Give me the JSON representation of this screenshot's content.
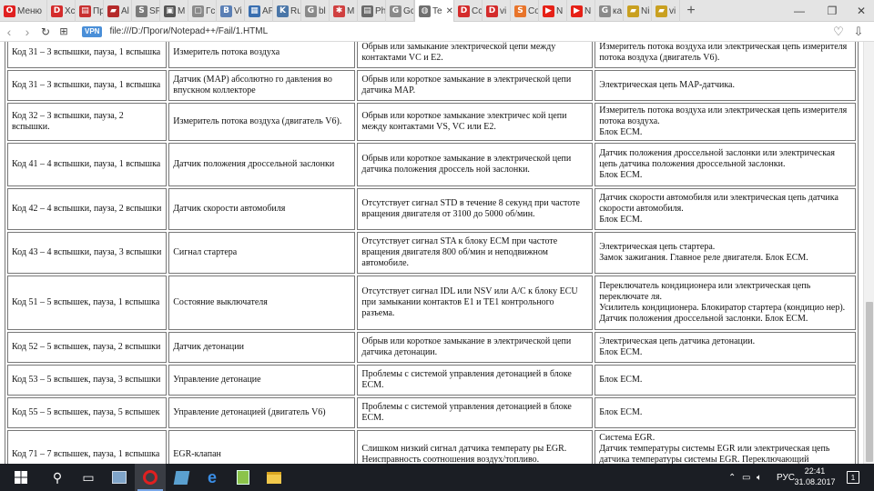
{
  "browser": {
    "tabs": [
      {
        "label": "Меню",
        "icon": "opera-menu-icon",
        "glyph": "O",
        "color": "#e02020"
      },
      {
        "label": "Xc",
        "icon": "d-site-icon",
        "glyph": "D",
        "color": "#d42b2b"
      },
      {
        "label": "Пр",
        "icon": "news-site-icon",
        "glyph": "▤",
        "color": "#c83030"
      },
      {
        "label": "Al",
        "icon": "car-site-icon",
        "glyph": "▰",
        "color": "#b52a2a"
      },
      {
        "label": "SF",
        "icon": "s-site-icon",
        "glyph": "S",
        "color": "#7a7a7a"
      },
      {
        "label": "M",
        "icon": "m-site-icon",
        "glyph": "▣",
        "color": "#555555"
      },
      {
        "label": "Гс",
        "icon": "page-icon",
        "glyph": "▢",
        "color": "#8a8a8a"
      },
      {
        "label": "Vi",
        "icon": "vk-icon",
        "glyph": "B",
        "color": "#5a7fb5"
      },
      {
        "label": "AF",
        "icon": "af-site-icon",
        "glyph": "▦",
        "color": "#3a6fb0"
      },
      {
        "label": "Ru",
        "icon": "vk-blue-icon",
        "glyph": "K",
        "color": "#4a76a8"
      },
      {
        "label": "bl",
        "icon": "google-icon",
        "glyph": "G",
        "color": "#8a8a8a"
      },
      {
        "label": "M",
        "icon": "star-site-icon",
        "glyph": "✱",
        "color": "#d04040"
      },
      {
        "label": "Ph",
        "icon": "document-icon",
        "glyph": "▤",
        "color": "#6a6a6a"
      },
      {
        "label": "Gc",
        "icon": "google-icon",
        "glyph": "G",
        "color": "#8a8a8a"
      },
      {
        "label": "Te",
        "icon": "globe-icon",
        "glyph": "◍",
        "color": "#707070",
        "active": true
      },
      {
        "label": "Cc",
        "icon": "d-site-icon",
        "glyph": "D",
        "color": "#d42b2b"
      },
      {
        "label": "vi",
        "icon": "d-site-icon",
        "glyph": "D",
        "color": "#d42b2b"
      },
      {
        "label": "Co",
        "icon": "s-orange-icon",
        "glyph": "S",
        "color": "#e8742a"
      },
      {
        "label": "N",
        "icon": "youtube-icon",
        "glyph": "▶",
        "color": "#e62117"
      },
      {
        "label": "N",
        "icon": "youtube-icon",
        "glyph": "▶",
        "color": "#e62117"
      },
      {
        "label": "ка",
        "icon": "google-icon",
        "glyph": "G",
        "color": "#8a8a8a"
      },
      {
        "label": "Ni",
        "icon": "car-yellow-icon",
        "glyph": "▰",
        "color": "#c9a020"
      },
      {
        "label": "vi",
        "icon": "car-yellow-icon",
        "glyph": "▰",
        "color": "#c9a020"
      }
    ],
    "new_tab": "+",
    "url": "file:///D:/Проги/Notepad++/Fail/1.HTML",
    "vpn_label": "VPN"
  },
  "table": {
    "rows": [
      {
        "code": "Код 31 – 3 вспышки, пауза, 1 вспышка",
        "sensor": "Измеритель потока воздуха",
        "cause": "Обрыв или замыкание электрической цепи между контактами VC и E2.",
        "fault": "Измеритель потока воздуха или электрическая цепь измерителя потока воздуха (двигатель V6)."
      },
      {
        "code": "Код 31 – 3 вспышки, пауза, 1 вспышка",
        "sensor": "Датчик (MAP) абсолютно го давления во впускном коллекторе",
        "cause": "Обрыв или короткое замыкание в электрической цепи датчика MAP.",
        "fault": "Электрическая цепь MAP-датчика."
      },
      {
        "code": "Код 32 – 3 вспышки, пауза, 2 вспышки.",
        "sensor": "Измеритель потока воздуха (двигатель V6).",
        "cause": "Обрыв или короткое замыкание электричес кой цепи между контактами VS, VC или E2.",
        "fault": "Измеритель потока воздуха или электрическая цепь измерителя потока воздуха.\nБлок ECM."
      },
      {
        "code": "Код 41 – 4 вспышки, пауза, 1 вспышка",
        "sensor": "Датчик положения дроссельной заслонки",
        "cause": "Обрыв или короткое замыкание в электрической цепи датчика положения дроссель ной заслонки.",
        "fault": "Датчик положения дроссельной заслонки или электрическая цепь датчика положения дроссельной заслонки.\nБлок ECM."
      },
      {
        "code": "Код 42 – 4 вспышки, пауза, 2 вспышки",
        "sensor": "Датчик скорости автомобиля",
        "cause": "Отсутствует сигнал STD в течение 8 секунд при частоте вращения двигателя от 3100 до 5000 об/мин.",
        "fault": "Датчик скорости автомобиля или электрическая цепь датчика скорости автомобиля.\nБлок ECM."
      },
      {
        "code": "Код 43 – 4 вспышки, пауза, 3 вспышки",
        "sensor": "Сигнал стартера",
        "cause": "Отсутствует сигнал STA к блоку ECM при частоте вращения двигателя 800 об/мин и неподвижном автомобиле.",
        "fault": "Электрическая цепь стартера.\nЗамок зажигания. Главное реле двигателя. Блок ECM."
      },
      {
        "code": "Код 51 – 5 вспышек, пауза, 1 вспышка",
        "sensor": "Состояние выключателя",
        "cause": "Отсутствует сигнал IDL или NSV или A/C к блоку ECU при замыкании контактов E1 и TE1 контрольного разъема.",
        "fault": "Переключатель кондиционера или электрическая цепь переключате ля.\nУсилитель кондиционера. Блокиратор стартера (кондицио нер).\nДатчик положения дроссельной заслонки. Блок ECM."
      },
      {
        "code": "Код 52 – 5 вспышек, пауза, 2 вспышки",
        "sensor": "Датчик детонации",
        "cause": "Обрыв или короткое замыкание в электрической цепи датчика детонации.",
        "fault": "Электрическая цепь датчика детонации.\nБлок ECM."
      },
      {
        "code": "Код 53 – 5 вспышек, пауза, 3 вспышки",
        "sensor": "Управление детонацие",
        "cause": "Проблемы с системой управления детонацией в блоке ECM.",
        "fault": "Блок ECM."
      },
      {
        "code": "Код 55 – 5 вспышек, пауза, 5 вспышек",
        "sensor": "Управление детонацией (двигатель V6)",
        "cause": "Проблемы с системой управления детонацией в блоке ECM.",
        "fault": "Блок ECM."
      },
      {
        "code": "Код 71 – 7 вспышек, пауза, 1 вспышка",
        "sensor": "EGR-клапан",
        "cause": "Слишком низкий сигнал датчика температу ры EGR.\nНеисправность соотношения воздух/топливо.",
        "fault": "Система EGR.\nДатчик температуры системы EGR или электрическая цепь датчика температуры системы EGR. Переключающий вакуумный клапан системы EGR. Блок ECM."
      }
    ]
  },
  "taskbar": {
    "language": "РУС",
    "time": "22:41",
    "date": "31.08.2017",
    "notifications": "1"
  }
}
